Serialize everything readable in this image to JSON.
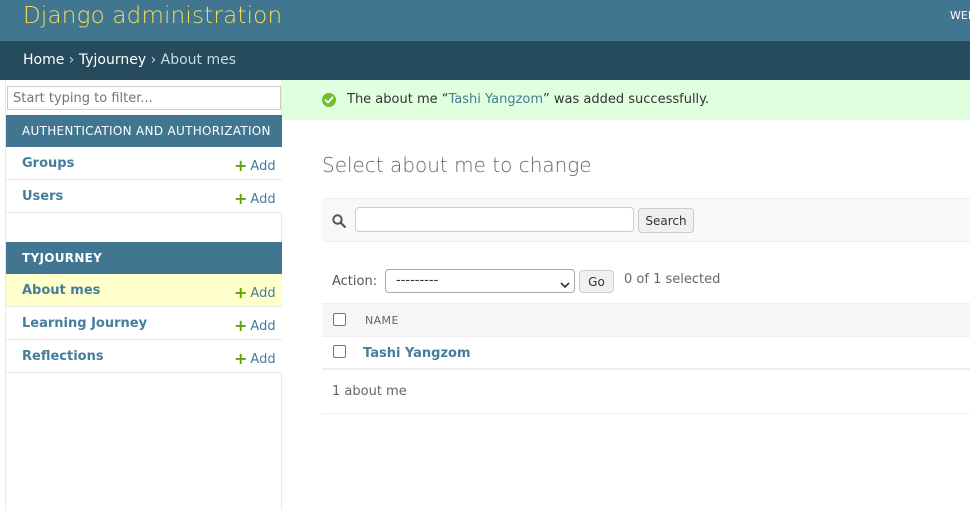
{
  "header": {
    "site_name": "Django administration",
    "user_tools": "WELCOME,"
  },
  "breadcrumbs": {
    "home": "Home",
    "app": "Tyjourney",
    "current": "About mes",
    "separator": "›"
  },
  "sidebar": {
    "filter_placeholder": "Start typing to filter...",
    "modules": [
      {
        "caption": "AUTHENTICATION AND AUTHORIZATION",
        "models": [
          {
            "name": "Groups",
            "add_label": "Add"
          },
          {
            "name": "Users",
            "add_label": "Add"
          }
        ]
      },
      {
        "caption": "TYJOURNEY",
        "models": [
          {
            "name": "About mes",
            "add_label": "Add",
            "current": true
          },
          {
            "name": "Learning Journey",
            "add_label": "Add"
          },
          {
            "name": "Reflections",
            "add_label": "Add"
          }
        ]
      }
    ]
  },
  "message": {
    "prefix": "The about me “",
    "object_link": "Tashi Yangzom",
    "suffix": "” was added successfully."
  },
  "content": {
    "title": "Select about me to change"
  },
  "search": {
    "value": "",
    "button_label": "Search"
  },
  "actions": {
    "label": "Action:",
    "selected_option": "---------",
    "go_label": "Go",
    "counter": "0 of 1 selected"
  },
  "table": {
    "columns": [
      "NAME"
    ],
    "rows": [
      {
        "name": "Tashi Yangzom"
      }
    ]
  },
  "paginator": {
    "text": "1 about me"
  },
  "colors": {
    "header_bg": "#417690",
    "breadcrumbs_bg": "#264b5d",
    "site_name": "#f5dd5d",
    "link": "#447e9b",
    "success_bg": "#dfffdf",
    "add_plus": "#5aa700",
    "current_model_bg": "#ffffcc"
  }
}
